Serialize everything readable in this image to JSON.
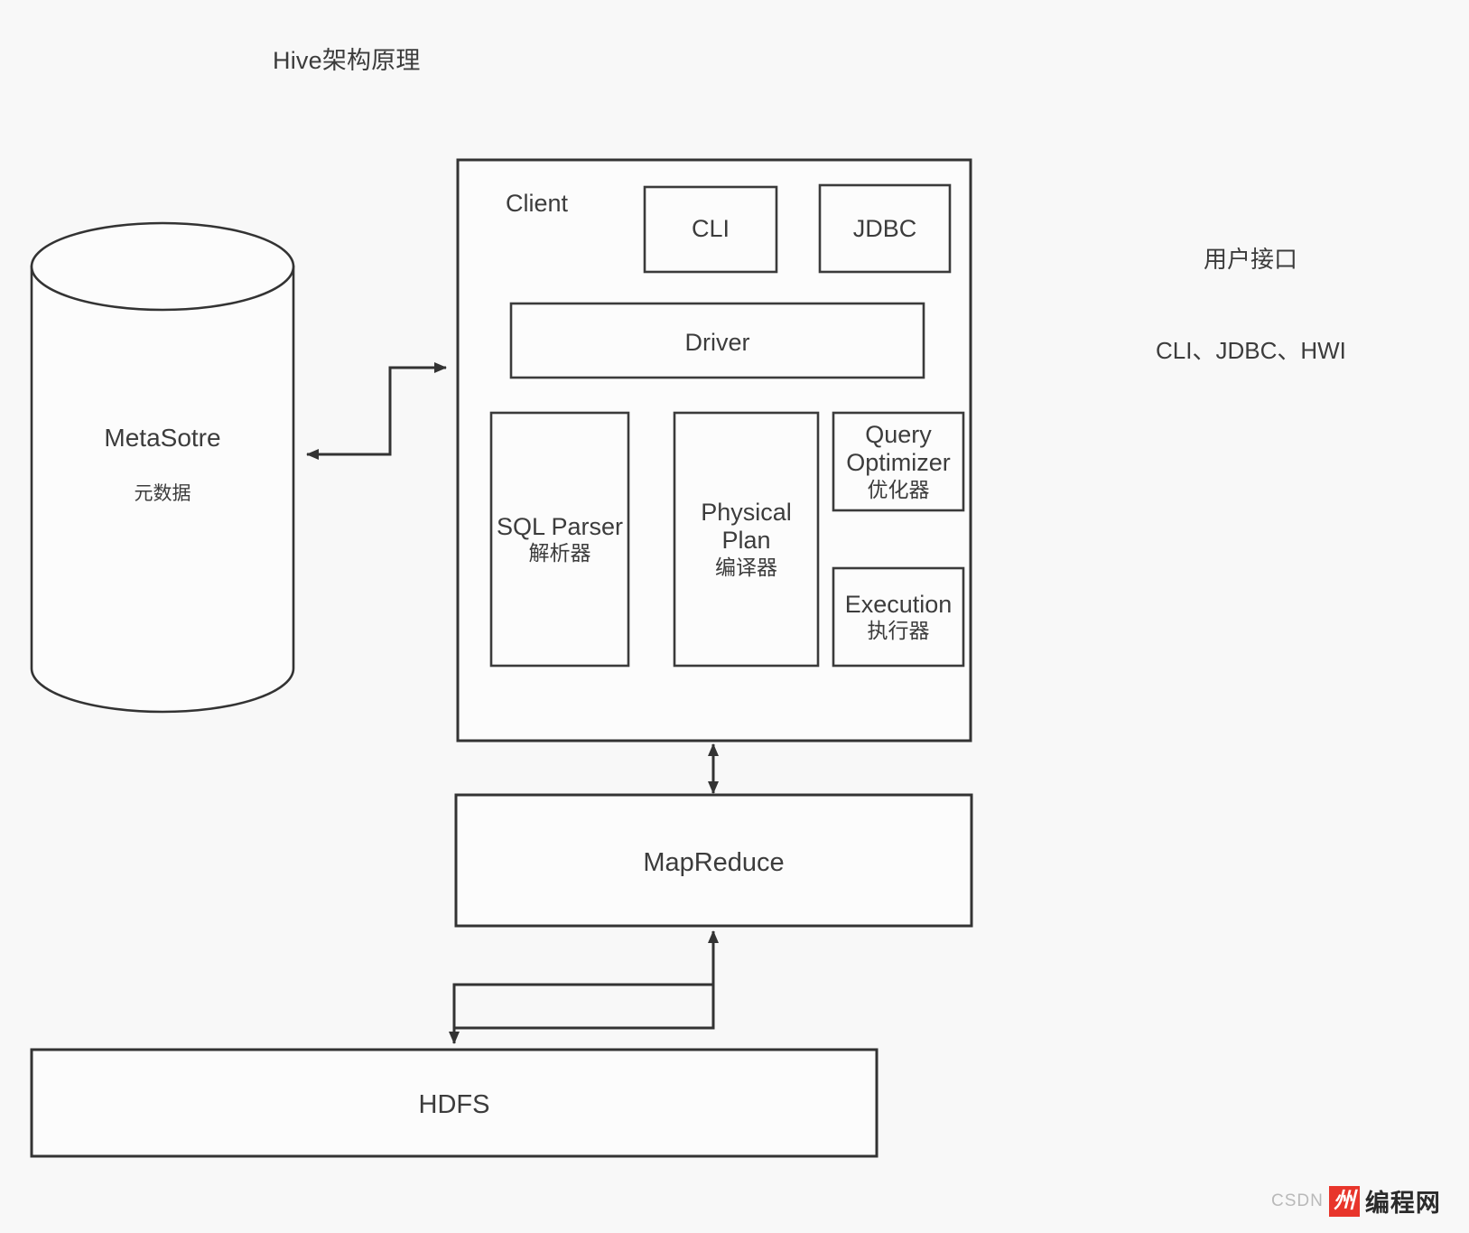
{
  "diagram": {
    "title": "Hive架构原理",
    "side_note": {
      "line1": "用户接口",
      "line2": "CLI、JDBC、HWI"
    },
    "metastore": {
      "name": "MetaSotre",
      "subtitle": "元数据"
    },
    "client": {
      "label": "Client",
      "interfaces": [
        {
          "label": "CLI"
        },
        {
          "label": "JDBC"
        }
      ],
      "driver": {
        "label": "Driver"
      },
      "components": [
        {
          "label": "SQL Parser",
          "label_cn": "解析器"
        },
        {
          "label": "Physical\nPlan",
          "label_cn": "编译器"
        },
        {
          "label": "Query\nOptimizer",
          "label_cn": "优化器"
        },
        {
          "label": "Execution",
          "label_cn": "执行器"
        }
      ]
    },
    "mapreduce": {
      "label": "MapReduce"
    },
    "hdfs": {
      "label": "HDFS"
    },
    "colors": {
      "stroke": "#333333",
      "background": "#f8f8f8",
      "fill": "#fcfcfc",
      "text": "#3c3c3c",
      "watermark_red": "#e8352b"
    }
  },
  "watermark": {
    "csdn": "CSDN",
    "logo_glyph": "州",
    "site": "编程网"
  }
}
